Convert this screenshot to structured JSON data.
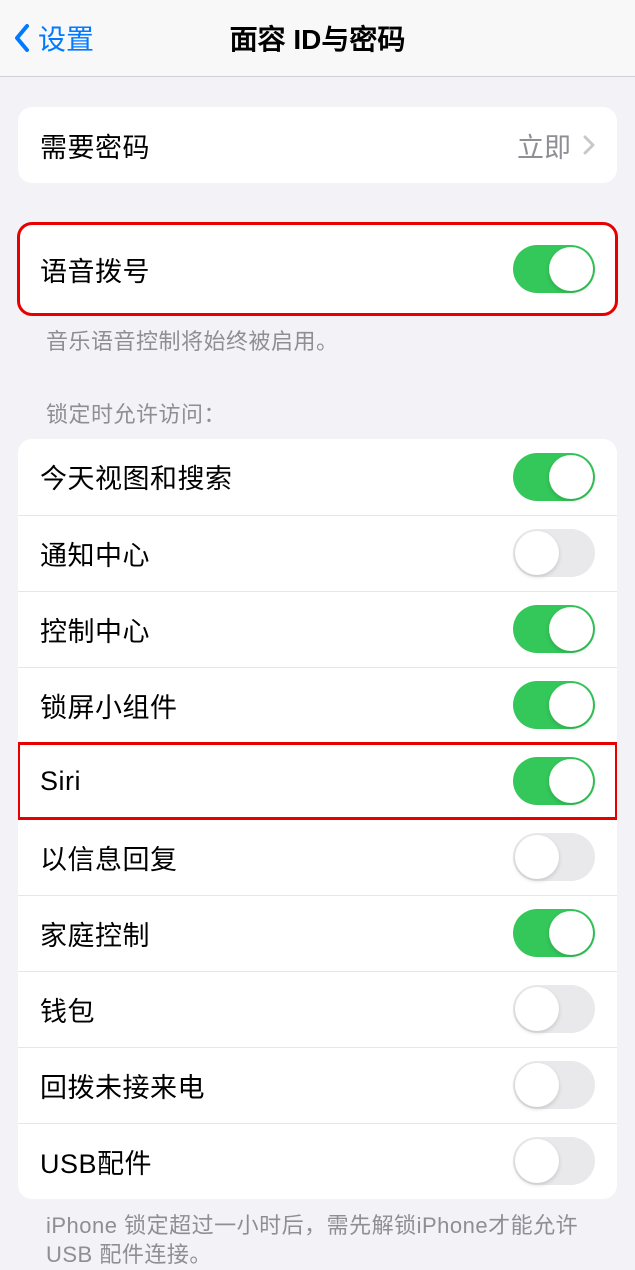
{
  "header": {
    "back_label": "设置",
    "title": "面容 ID与密码"
  },
  "passcode_require": {
    "label": "需要密码",
    "value": "立即"
  },
  "voice_dial": {
    "label": "语音拨号",
    "on": true,
    "footnote": "音乐语音控制将始终被启用。"
  },
  "locked_access": {
    "header": "锁定时允许访问：",
    "items": [
      {
        "label": "今天视图和搜索",
        "on": true
      },
      {
        "label": "通知中心",
        "on": false
      },
      {
        "label": "控制中心",
        "on": true
      },
      {
        "label": "锁屏小组件",
        "on": true
      },
      {
        "label": "Siri",
        "on": true
      },
      {
        "label": "以信息回复",
        "on": false
      },
      {
        "label": "家庭控制",
        "on": true
      },
      {
        "label": "钱包",
        "on": false
      },
      {
        "label": "回拨未接来电",
        "on": false
      },
      {
        "label": "USB配件",
        "on": false
      }
    ],
    "footnote": "iPhone 锁定超过一小时后，需先解锁iPhone才能允许USB 配件连接。"
  }
}
